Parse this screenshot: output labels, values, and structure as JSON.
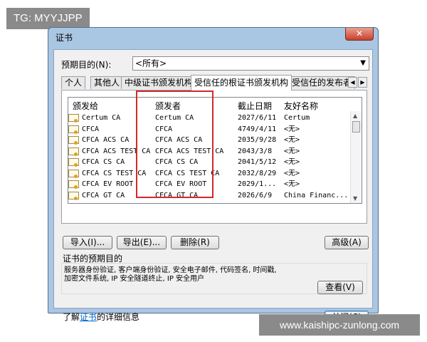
{
  "watermark_top": "TG: MYYJJPP",
  "watermark_bottom": "www.kaishipc-zunlong.com",
  "window": {
    "title": "证书",
    "close_glyph": "✕"
  },
  "purpose": {
    "label": "预期目的(N):",
    "value": "<所有>"
  },
  "tabs": [
    {
      "label": "个人"
    },
    {
      "label": "其他人"
    },
    {
      "label": "中级证书颁发机构"
    },
    {
      "label": "受信任的根证书颁发机构",
      "active": true
    },
    {
      "label": "受信任的发布者"
    }
  ],
  "columns": [
    "颁发给",
    "颁发者",
    "截止日期",
    "友好名称"
  ],
  "rows": [
    {
      "issued_to": "Certum CA",
      "issued_by": "Certum CA",
      "expires": "2027/6/11",
      "friendly": "Certum"
    },
    {
      "issued_to": "CFCA",
      "issued_by": "CFCA",
      "expires": "4749/4/11",
      "friendly": "<无>"
    },
    {
      "issued_to": "CFCA ACS CA",
      "issued_by": "CFCA ACS CA",
      "expires": "2035/9/28",
      "friendly": "<无>"
    },
    {
      "issued_to": "CFCA ACS TEST CA",
      "issued_by": "CFCA ACS TEST CA",
      "expires": "2043/3/8",
      "friendly": "<无>"
    },
    {
      "issued_to": "CFCA CS CA",
      "issued_by": "CFCA CS CA",
      "expires": "2041/5/12",
      "friendly": "<无>"
    },
    {
      "issued_to": "CFCA CS TEST CA",
      "issued_by": "CFCA CS TEST CA",
      "expires": "2032/8/29",
      "friendly": "<无>"
    },
    {
      "issued_to": "CFCA EV ROOT",
      "issued_by": "CFCA EV ROOT",
      "expires": "2029/1...",
      "friendly": "<无>"
    },
    {
      "issued_to": "CFCA GT CA",
      "issued_by": "CFCA GT CA",
      "expires": "2026/6/9",
      "friendly": "China Financ..."
    }
  ],
  "buttons": {
    "import": "导入(I)...",
    "export": "导出(E)...",
    "delete": "删除(R)",
    "advanced": "高级(A)",
    "view": "查看(V)",
    "close": "关闭(C)"
  },
  "purposes_group": {
    "title": "证书的预期目的",
    "line1": "服务器身份验证, 客户端身份验证, 安全电子邮件, 代码签名, 时间戳,",
    "line2": "加密文件系统, IP 安全隧道终止, IP 安全用户"
  },
  "learn_more": {
    "prefix": "了解",
    "link": "证书",
    "suffix": "的详细信息"
  },
  "highlight_color": "#d02a2a"
}
